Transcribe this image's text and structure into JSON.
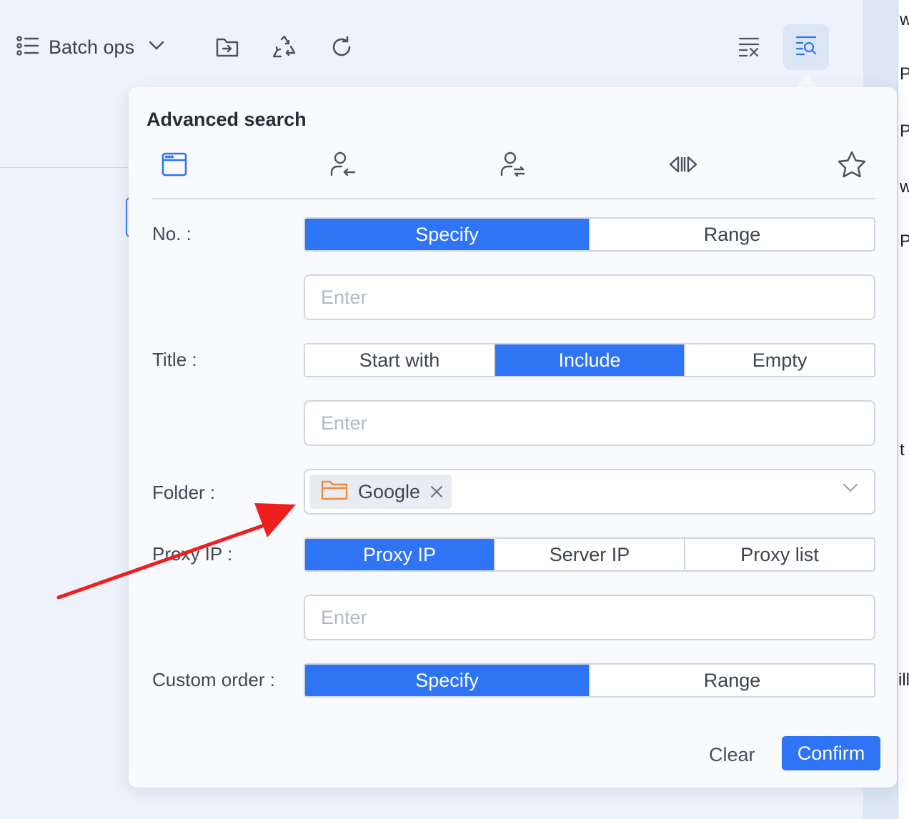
{
  "toolbar": {
    "batch_label": "Batch ops",
    "icons": [
      "list-icon",
      "chevron-down-icon",
      "folder-move-icon",
      "recycle-icon",
      "refresh-icon",
      "clear-filter-icon",
      "advanced-search-icon"
    ]
  },
  "background_text": [
    "w",
    "P",
    "P",
    "w",
    "P",
    "t",
    "ill"
  ],
  "panel": {
    "title": "Advanced search",
    "tabs": [
      "browser-window-icon",
      "user-import-icon",
      "user-transfer-icon",
      "split-view-icon",
      "star-icon"
    ],
    "rows": {
      "no": {
        "label": "No. :",
        "options": [
          "Specify",
          "Range"
        ],
        "selected": "Specify",
        "placeholder": "Enter"
      },
      "title": {
        "label": "Title :",
        "options": [
          "Start with",
          "Include",
          "Empty"
        ],
        "selected": "Include",
        "placeholder": "Enter"
      },
      "folder": {
        "label": "Folder :",
        "selected_tag": "Google"
      },
      "proxy_ip": {
        "label": "Proxy IP :",
        "options": [
          "Proxy IP",
          "Server IP",
          "Proxy list"
        ],
        "selected": "Proxy IP",
        "placeholder": "Enter"
      },
      "custom_order": {
        "label": "Custom order :",
        "options": [
          "Specify",
          "Range"
        ],
        "selected": "Specify"
      }
    },
    "clear_label": "Clear",
    "confirm_label": "Confirm"
  },
  "colors": {
    "accent": "#2f74f5",
    "annotation_arrow": "#f01f1f",
    "folder_icon": "#f08a3c"
  }
}
